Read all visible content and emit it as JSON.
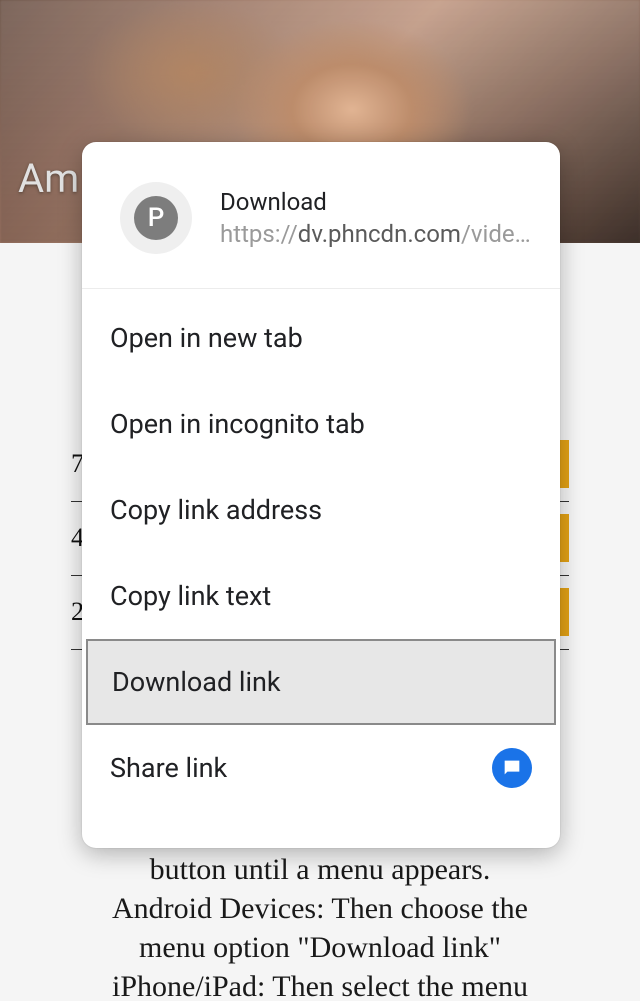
{
  "background": {
    "title_fragment": "Am",
    "rows": [
      {
        "number": "7"
      },
      {
        "number": "4"
      },
      {
        "number": "2"
      }
    ],
    "instructions_line1": "button until a menu appears.",
    "instructions_line2": "Android Devices: Then choose the",
    "instructions_line3": "menu option \"Download link\"",
    "instructions_line4": "iPhone/iPad: Then select the menu"
  },
  "sheet": {
    "favicon_letter": "P",
    "title": "Download",
    "url_prefix": "https://",
    "url_domain": "dv.phncdn.com",
    "url_path": "/vide…",
    "items": {
      "open_new_tab": "Open in new tab",
      "open_incognito": "Open in incognito tab",
      "copy_address": "Copy link address",
      "copy_text": "Copy link text",
      "download_link": "Download link",
      "share_link": "Share link"
    }
  }
}
